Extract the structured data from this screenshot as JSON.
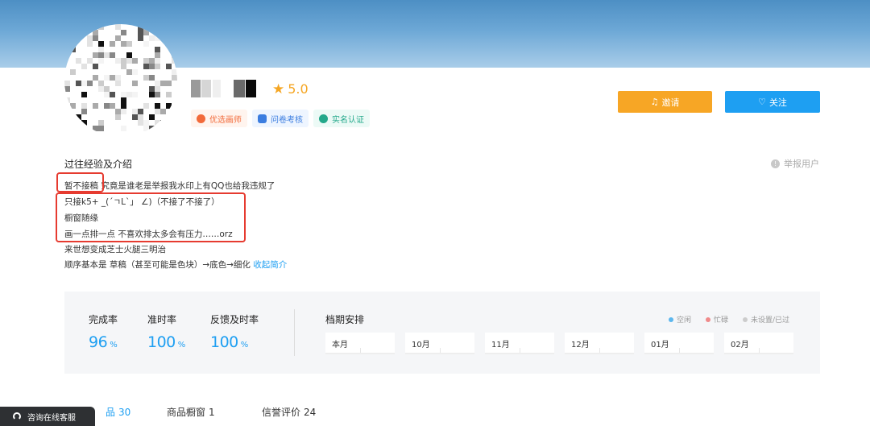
{
  "profile": {
    "rating": "5.0",
    "badges": [
      {
        "label": "优选画师",
        "icon": "hexagon-star-icon",
        "color": "#f26a3a"
      },
      {
        "label": "问卷考核",
        "icon": "checklist-icon",
        "color": "#3b7de0"
      },
      {
        "label": "实名认证",
        "icon": "id-card-icon",
        "color": "#23a88a"
      }
    ]
  },
  "actions": {
    "invite_label": "邀请",
    "follow_label": "关注"
  },
  "about": {
    "title": "过往经验及介绍",
    "report_label": "举报用户",
    "lines": [
      "暂不接稿  究竟是谁老是举报我水印上有QQ也给我违规了",
      "只接k5+ _(´ㄱL`」 ∠)（不接了不接了）",
      "橱窗随缘",
      "画一点排一点 不喜欢排太多会有压力……orz",
      "来世想变成芝士火腿三明治",
      "顺序基本是 草稿（甚至可能是色块）→底色→细化"
    ],
    "collapse_label": "收起简介"
  },
  "stats": [
    {
      "label": "完成率",
      "value": "96",
      "unit": "%"
    },
    {
      "label": "准时率",
      "value": "100",
      "unit": "%"
    },
    {
      "label": "反馈及时率",
      "value": "100",
      "unit": "%"
    }
  ],
  "schedule": {
    "title": "档期安排",
    "legend": [
      {
        "label": "空闲",
        "color": "#5cb7ee"
      },
      {
        "label": "忙碌",
        "color": "#f08a8a"
      },
      {
        "label": "未设置/已过",
        "color": "#cccccc"
      }
    ],
    "months": [
      "本月",
      "10月",
      "11月",
      "12月",
      "01月",
      "02月"
    ]
  },
  "tabs": [
    {
      "label": "品",
      "count": "30"
    },
    {
      "label": "商品橱窗",
      "count": "1"
    },
    {
      "label": "信誉评价",
      "count": "24"
    }
  ],
  "customer_service": {
    "label": "咨询在线客服"
  },
  "colors": {
    "accent": "#1e9ff2",
    "invite": "#f7a625",
    "highlight": "#e63b30"
  }
}
